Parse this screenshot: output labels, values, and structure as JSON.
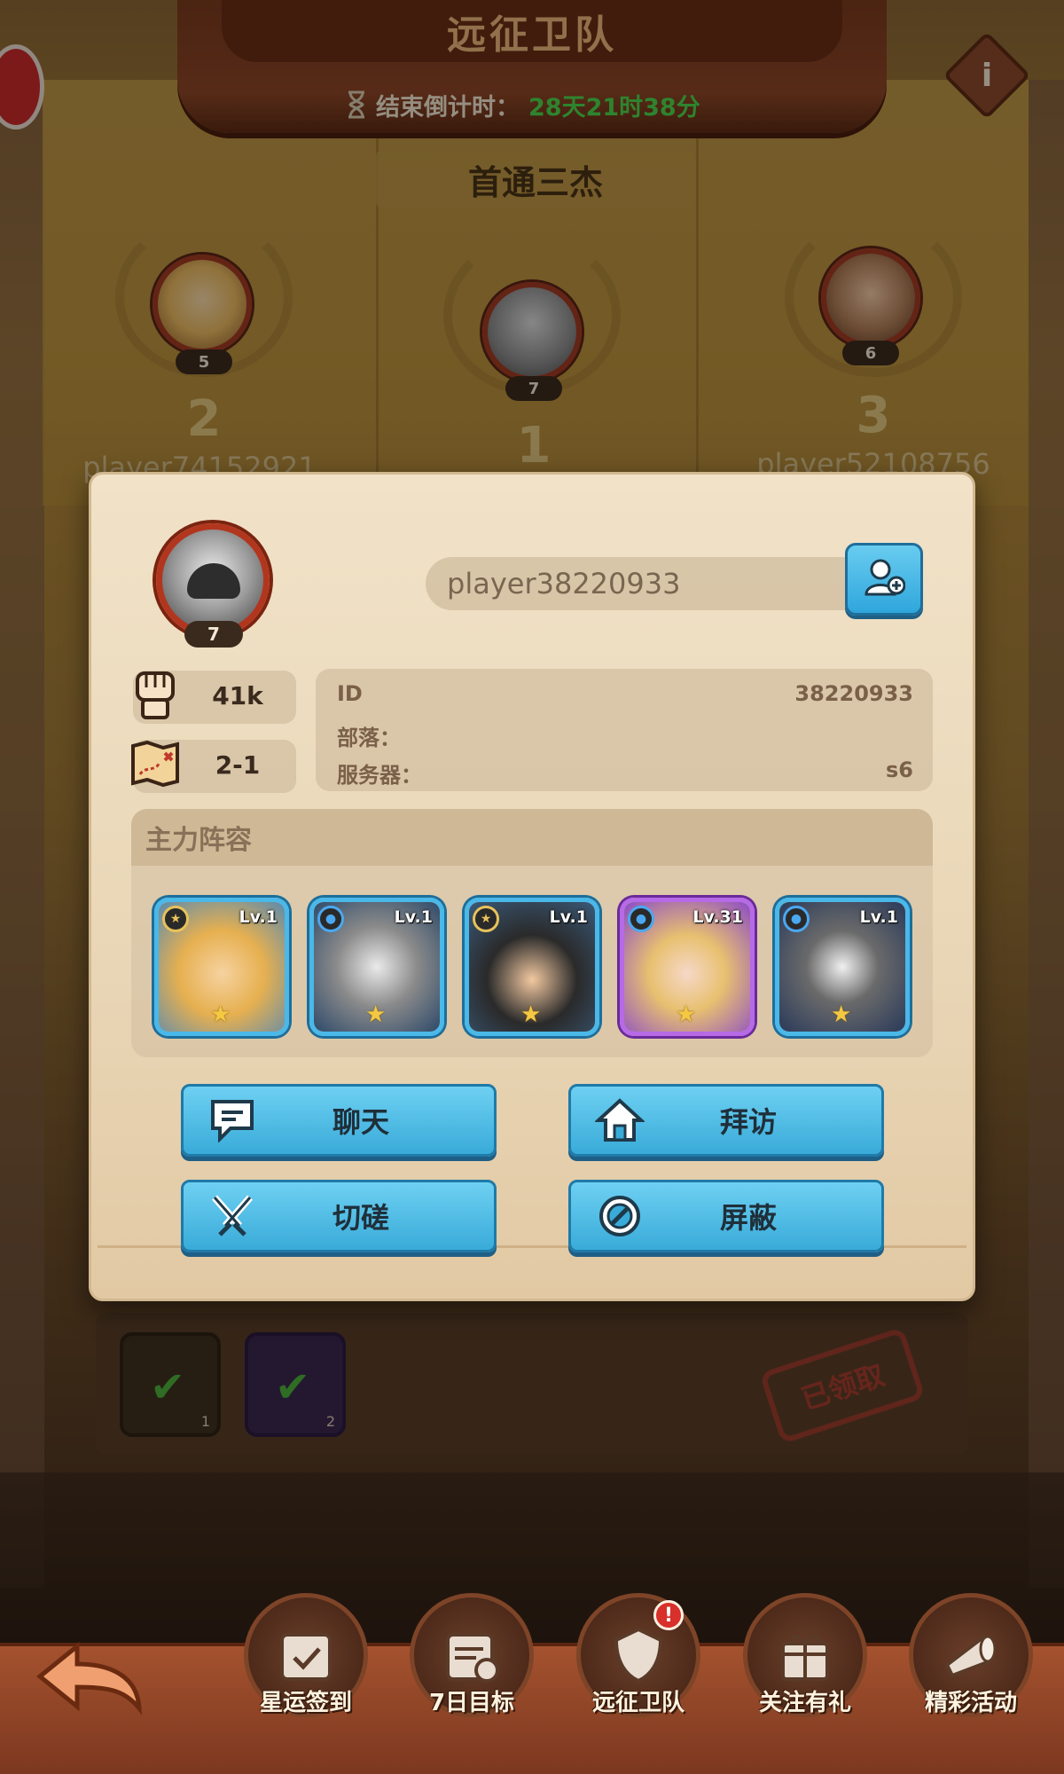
{
  "header": {
    "title": "远征卫队",
    "countdown_label": "结束倒计时：",
    "countdown_value": "28天21时38分"
  },
  "podium": {
    "title": "首通三杰",
    "entries": [
      {
        "rank": "2",
        "level": "5",
        "name": "player74152921"
      },
      {
        "rank": "1",
        "level": "7",
        "name": ""
      },
      {
        "rank": "3",
        "level": "6",
        "name": "player52108756"
      }
    ]
  },
  "profile": {
    "level": "7",
    "name": "player38220933",
    "power": "41k",
    "stage": "2-1",
    "id_label": "ID",
    "id_value": "38220933",
    "tribe_label": "部落：",
    "tribe_value": "",
    "server_label": "服务器：",
    "server_value": "s6"
  },
  "lineup": {
    "title": "主力阵容",
    "heroes": [
      {
        "level": "Lv.1",
        "rarity": "blue",
        "element": "gold",
        "stars": 1
      },
      {
        "level": "Lv.1",
        "rarity": "blue",
        "element": "water",
        "stars": 1
      },
      {
        "level": "Lv.1",
        "rarity": "blue",
        "element": "gold",
        "stars": 1
      },
      {
        "level": "Lv.31",
        "rarity": "purple",
        "element": "water",
        "stars": 1
      },
      {
        "level": "Lv.1",
        "rarity": "blue",
        "element": "water",
        "stars": 1
      }
    ]
  },
  "actions": {
    "chat": "聊天",
    "visit": "拜访",
    "duel": "切磋",
    "block": "屏蔽"
  },
  "rewards": {
    "slot1_count": "1",
    "slot2_count": "2",
    "claimed": "已领取"
  },
  "nav": {
    "items": [
      {
        "label": "星运签到",
        "icon": "calendar-check-icon"
      },
      {
        "label": "7日目标",
        "icon": "calendar-goal-icon"
      },
      {
        "label": "远征卫队",
        "icon": "guard-shield-icon",
        "badge": "!"
      },
      {
        "label": "关注有礼",
        "icon": "gift-heart-icon"
      },
      {
        "label": "精彩活动",
        "icon": "horn-drum-icon"
      }
    ]
  },
  "colors": {
    "accent_blue": "#39abd9",
    "countdown_green": "#4bd54b",
    "panel_bg": "#ecdcbd",
    "frame_red": "#b2361e"
  }
}
